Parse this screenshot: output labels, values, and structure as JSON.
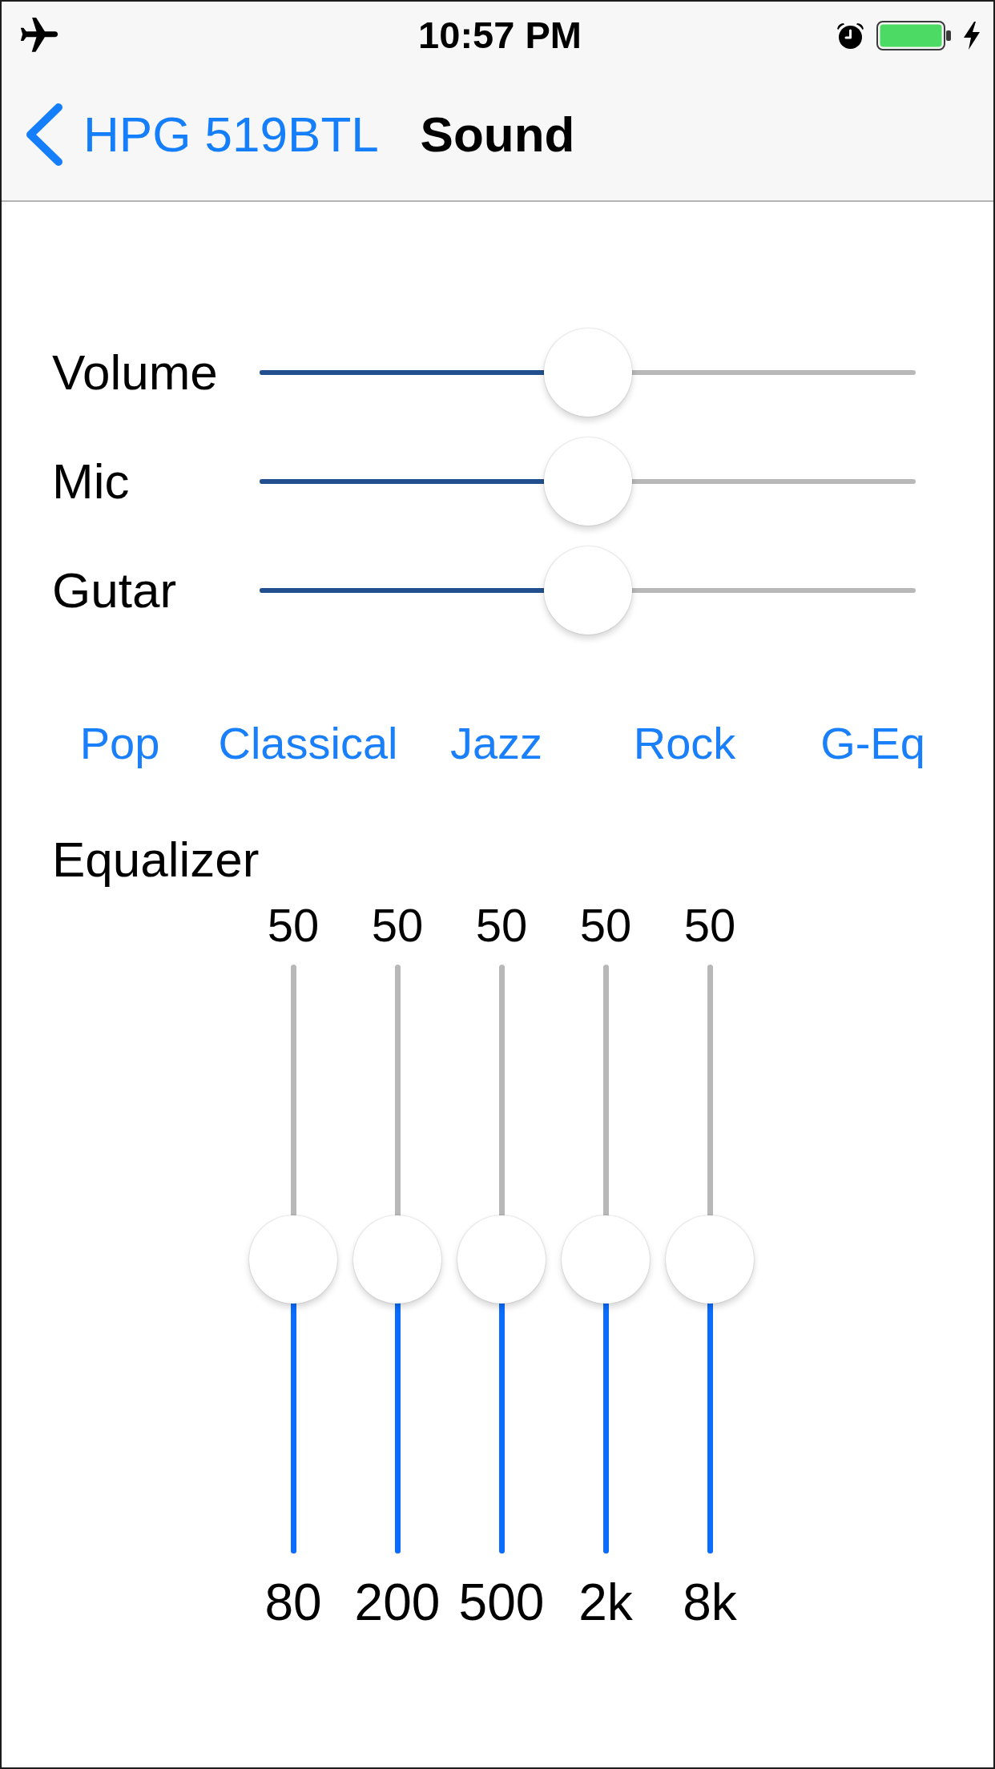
{
  "status_bar": {
    "time": "10:57 PM"
  },
  "nav_bar": {
    "back_label": "HPG 519BTL",
    "title": "Sound"
  },
  "channels": [
    {
      "label": "Volume",
      "level": 0.5
    },
    {
      "label": "Mic",
      "level": 0.5
    },
    {
      "label": "Gutar",
      "level": 0.5
    }
  ],
  "presets": [
    "Pop",
    "Classical",
    "Jazz",
    "Rock",
    "G-Eq"
  ],
  "equalizer": {
    "title": "Equalizer",
    "bands": [
      {
        "value": "50",
        "level": 0.5,
        "frequency": "80"
      },
      {
        "value": "50",
        "level": 0.5,
        "frequency": "200"
      },
      {
        "value": "50",
        "level": 0.5,
        "frequency": "500"
      },
      {
        "value": "50",
        "level": 0.5,
        "frequency": "2k"
      },
      {
        "value": "50",
        "level": 0.5,
        "frequency": "8k"
      }
    ]
  }
}
